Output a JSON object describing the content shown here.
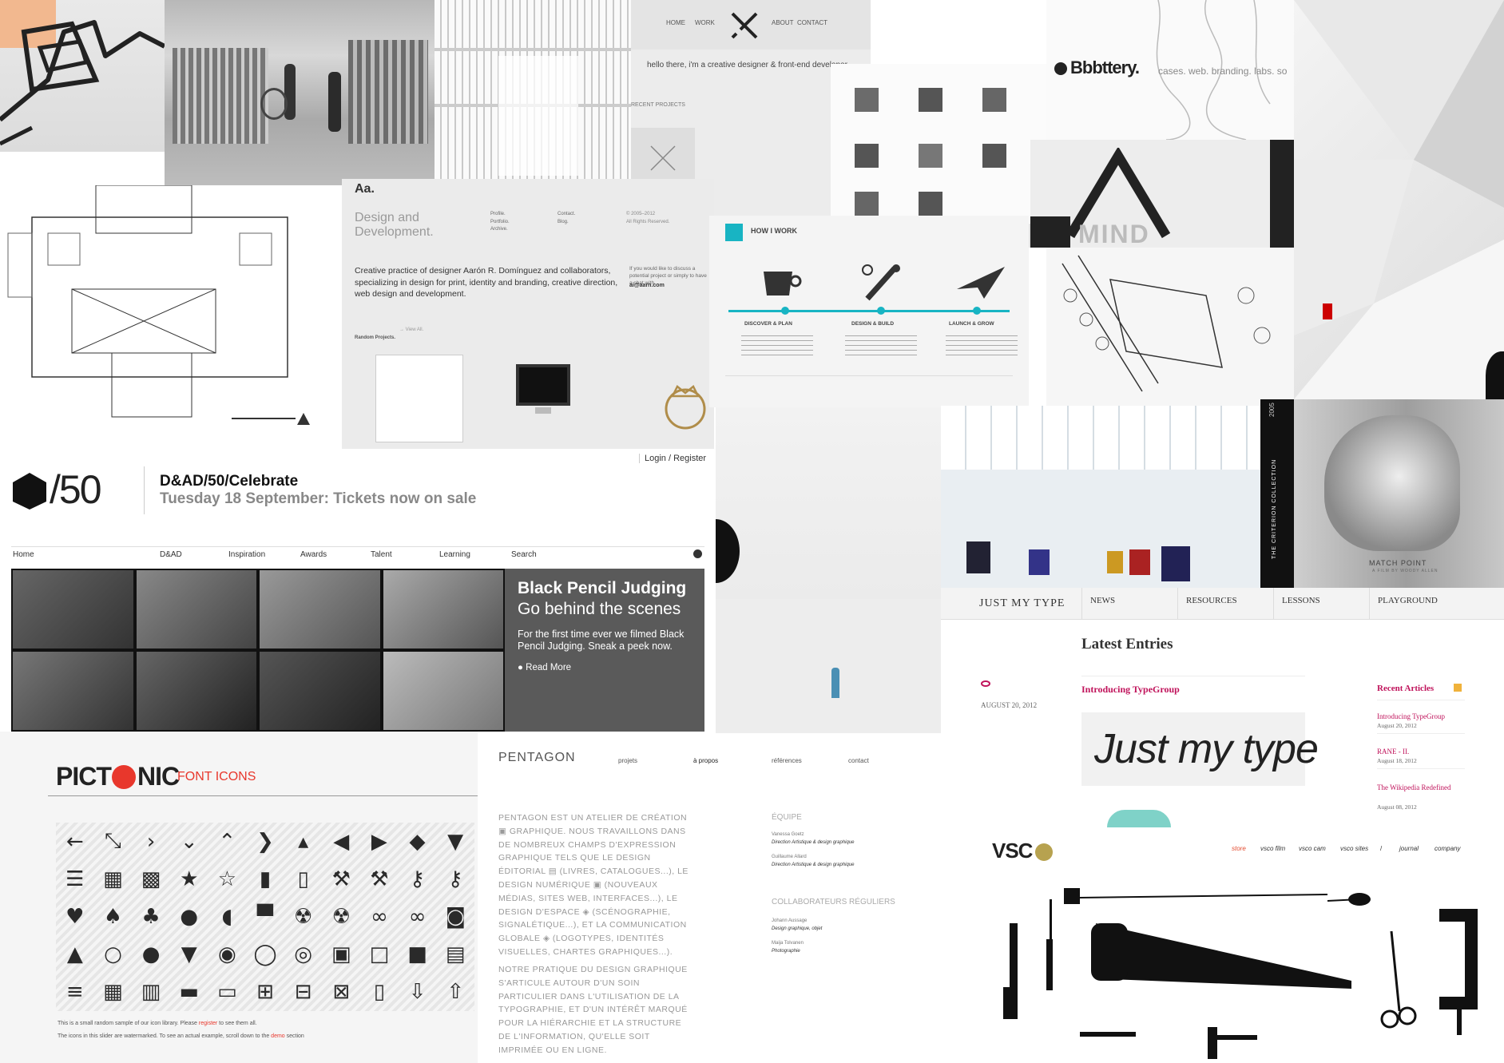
{
  "collage": {
    "work_site": {
      "nav": [
        "HOME",
        "WORK",
        "ABOUT",
        "CONTACT"
      ],
      "intro": "hello there, i'm a creative designer & front-end developer",
      "recent_projects": "RECENT PROJECTS"
    },
    "bbbttery": {
      "logo": "Bbbttery.",
      "nav": "cases. web. branding. labs. so"
    },
    "aaron": {
      "logo": "Aa.",
      "tagline": "Design and\nDevelopment.",
      "menu1": "Profile.\nPortfolio.\nArchive.",
      "menu2": "Contact.\nBlog.",
      "copyright": "© 2005–2012\nAll Rights Reserved.",
      "blurb": "Creative practice of designer Aarón R. Domínguez and collaborators, specializing in design for print, identity and branding, creative direction, web design and development.",
      "contact": "If you would like to discuss a potential project or simply to have a chat with",
      "email": "ai@aarn.com",
      "random": "Random Projects.",
      "view_all": "→ View All."
    },
    "how_i_work": {
      "title": "HOW I WORK",
      "steps": [
        "DISCOVER & PLAN",
        "DESIGN & BUILD",
        "LAUNCH & GROW"
      ]
    },
    "tmind": {
      "text": "MIND"
    },
    "dad": {
      "login": "Login / Register",
      "logo_num": "/50",
      "title": "D&AD/50/Celebrate",
      "subtitle": "Tuesday 18 September: Tickets now on sale",
      "nav": [
        "Home",
        "D&AD",
        "Inspiration",
        "Awards",
        "Talent",
        "Learning",
        "Search"
      ],
      "feature_title": "Black Pencil Judging",
      "feature_sub": "Go behind the scenes",
      "feature_text": "For the first time ever we filmed Black Pencil Judging. Sneak a peek now.",
      "read_more": "Read More"
    },
    "criterion": {
      "year": "2005",
      "label": "THE CRITERION COLLECTION",
      "film": "MATCH POINT",
      "credit": "A FILM BY WOODY ALLEN"
    },
    "jmt": {
      "logo": "JUST MY TYPE",
      "nav": [
        "NEWS",
        "RESOURCES",
        "LESSONS",
        "PLAYGROUND"
      ],
      "latest": "Latest Entries",
      "date": "AUGUST 20, 2012",
      "entry_title": "Introducing TypeGroup",
      "hero": "Just my type",
      "recent": "Recent Articles",
      "articles": [
        {
          "title": "Introducing TypeGroup",
          "date": "August 20, 2012"
        },
        {
          "title": "RANE - II.",
          "date": "August 18, 2012"
        },
        {
          "title": "The Wikipedia Redefined",
          "date": "August 08, 2012"
        }
      ]
    },
    "pictonic": {
      "logo_a": "PICT",
      "logo_b": "NIC",
      "logo_sub": "FONT ICONS",
      "note1_a": "This is a small random sample of our icon library. Please ",
      "note1_link": "register",
      "note1_b": " to see them all.",
      "note2_a": "The icons in this slider are watermarked. To see an actual example, scroll down to the ",
      "note2_link": "demo",
      "note2_b": " section",
      "icons": [
        "arrow-left",
        "compress",
        "chevron-right",
        "chevron-down",
        "chevron-up",
        "circle-chevron-right",
        "square-chevron-up",
        "circle-left",
        "circle-right",
        "tag-left",
        "tag-down",
        "grid-list",
        "grid-large",
        "grid-small",
        "star",
        "star-outline",
        "battery",
        "battery-half",
        "wrench",
        "wrench-alt",
        "key",
        "key-alt",
        "heart",
        "spade",
        "club",
        "poo",
        "duck",
        "tshirt",
        "radiation",
        "radiation-circle",
        "infinity",
        "infinity-circle",
        "camera",
        "thumbs-up",
        "speech-bubble",
        "speech-bubble-solid",
        "thumbs-down",
        "chat",
        "chat-outline",
        "chat-double",
        "chat-dots",
        "chat-square",
        "chat-square-solid",
        "chat-more",
        "list",
        "qr-code",
        "barcode",
        "folder",
        "folder-user",
        "folder-add",
        "folder-remove",
        "folder-delete",
        "file",
        "file-download",
        "file-upload"
      ]
    },
    "pentagon": {
      "logo": "PENTAGON",
      "nav": [
        "projets",
        "à propos",
        "références",
        "contact"
      ],
      "body1": "PENTAGON EST UN ATELIER DE CRÉATION ▣ GRAPHIQUE. NOUS TRAVAILLONS DANS DE NOMBREUX CHAMPS D'EXPRESSION GRAPHIQUE TELS QUE LE DESIGN ÉDITORIAL ▤ (LIVRES, CATALOGUES...), LE DESIGN NUMÉRIQUE ▣ (NOUVEAUX MÉDIAS, SITES WEB, INTERFACES...), LE DESIGN D'ESPACE ◈ (SCÉNOGRAPHIE, SIGNALÉTIQUE...), ET LA COMMUNICATION GLOBALE ◈ (LOGOTYPES, IDENTITÉS VISUELLES, CHARTES GRAPHIQUES...).",
      "body2": "NOTRE PRATIQUE DU DESIGN GRAPHIQUE S'ARTICULE AUTOUR D'UN SOIN PARTICULIER DANS L'UTILISATION DE LA TYPOGRAPHIE, ET D'UN INTÉRÊT MARQUÉ POUR LA HIÉRARCHIE ET LA STRUCTURE DE L'INFORMATION, QU'ELLE SOIT IMPRIMÉE OU EN LIGNE.",
      "team_head": "ÉQUIPE",
      "team": [
        {
          "name": "Vanessa Goetz",
          "role": "Direction Artistique & design graphique"
        },
        {
          "name": "Guillaume Allard",
          "role": "Direction Artistique & design graphique"
        }
      ],
      "collab_head": "COLLABORATEURS RÉGULIERS",
      "collab": [
        {
          "name": "Johann Aussage",
          "role": "Design graphique, objet"
        },
        {
          "name": "Maija Tolvanen",
          "role": "Photographie"
        }
      ]
    },
    "vsco": {
      "logo": "VSC",
      "nav": [
        "store",
        "vsco film",
        "vsco cam",
        "vsco sites",
        "/",
        "journal",
        "company"
      ]
    }
  }
}
